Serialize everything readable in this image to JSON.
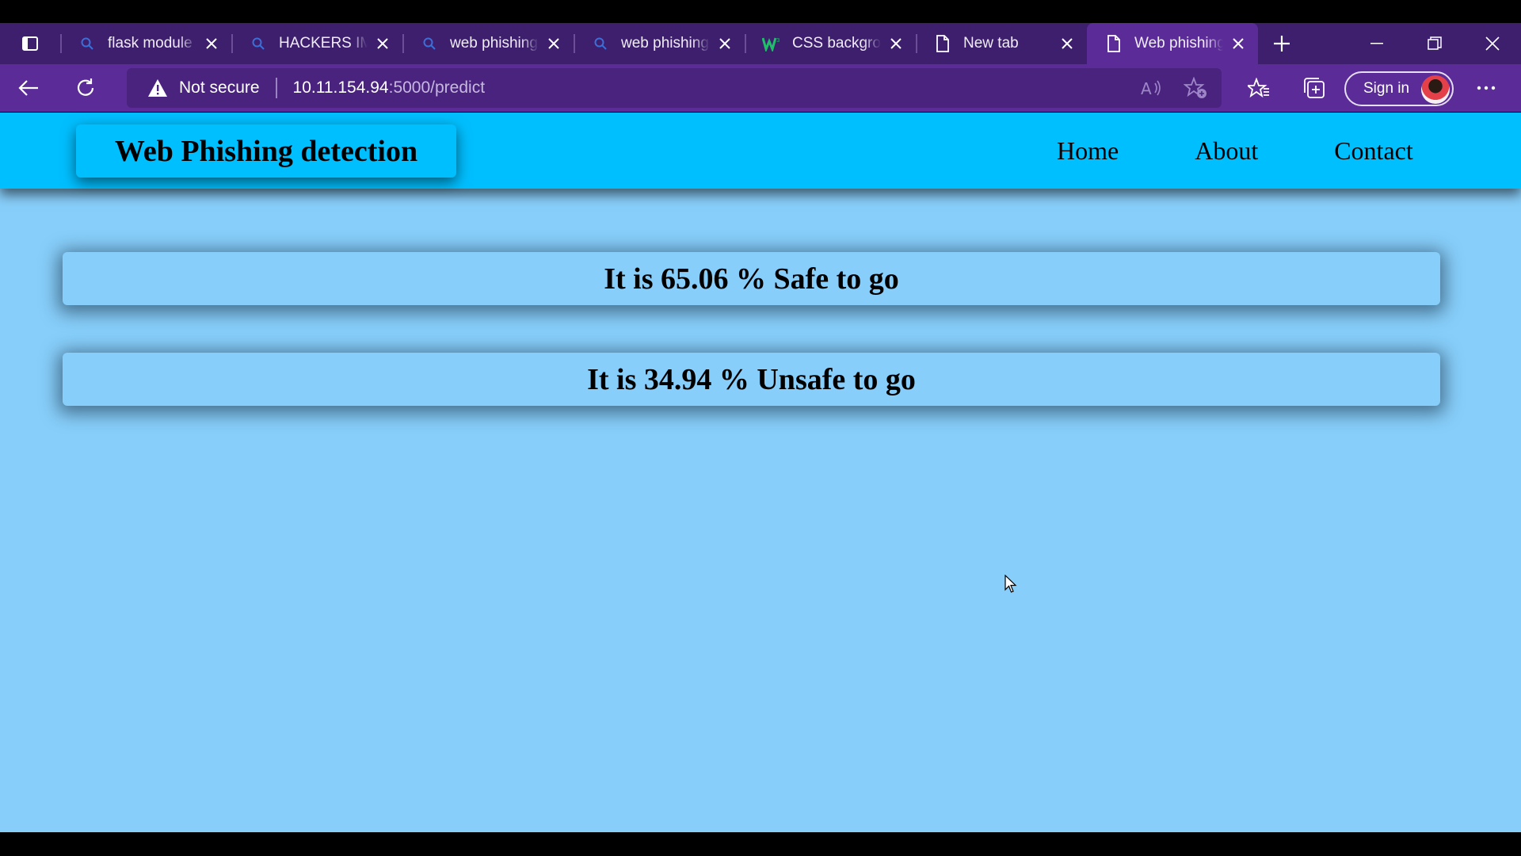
{
  "browser": {
    "tabs": [
      {
        "title": "flask module",
        "favicon": "search-icon"
      },
      {
        "title": "HACKERS IMAGES",
        "favicon": "search-icon"
      },
      {
        "title": "web phishing",
        "favicon": "search-icon"
      },
      {
        "title": "web phishing",
        "favicon": "search-icon"
      },
      {
        "title": "CSS background",
        "favicon": "w3schools-icon"
      },
      {
        "title": "New tab",
        "favicon": "page-icon"
      },
      {
        "title": "Web phishing",
        "favicon": "page-icon",
        "active": true
      }
    ],
    "security_text": "Not secure",
    "url_host": "10.11.154.94",
    "url_path": ":5000/predict",
    "signin_label": "Sign in"
  },
  "site": {
    "brand": "Web Phishing detection",
    "nav": {
      "home": "Home",
      "about": "About",
      "contact": "Contact"
    },
    "results": {
      "safe": "It is 65.06 % Safe to go",
      "unsafe": "It is 34.94 % Unsafe to go"
    }
  },
  "colors": {
    "tabbar": "#3d1f6e",
    "toolbar": "#5b2c97",
    "navbar": "#00bfff",
    "page_bg": "#87cefa"
  }
}
